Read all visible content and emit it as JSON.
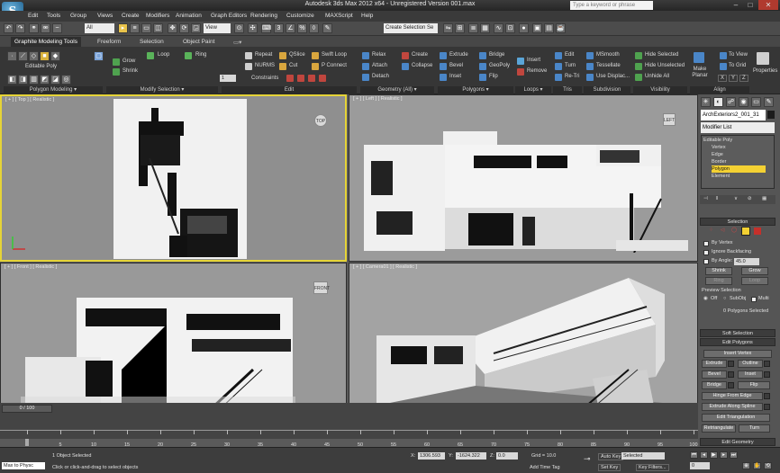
{
  "app": {
    "title": "Autodesk 3ds Max  2012 x64    - Unregistered Version   001.max",
    "search_placeholder": "Type a keyword or phrase",
    "logo_text": "S"
  },
  "menu": [
    "Edit",
    "Tools",
    "Group",
    "Views",
    "Create",
    "Modifiers",
    "Animation",
    "Graph Editors",
    "Rendering",
    "Customize",
    "MAXScript",
    "Help"
  ],
  "toolbar": {
    "selection_filter": "All",
    "ref_coord": "View",
    "named_selection": "Create Selection Se"
  },
  "ribbon": {
    "tabs": [
      "Graphite Modeling Tools",
      "Freeform",
      "Selection",
      "Object Paint"
    ],
    "object_type": "Editable Poly",
    "panels": {
      "polygon_modeling": "Polygon Modeling ▾",
      "modify_selection": "Modify Selection ▾",
      "edit": "Edit",
      "geometry_all": "Geometry (All) ▾",
      "polygons": "Polygons ▾",
      "loops": "Loops ▾",
      "tris": "Tris",
      "subdivision": "Subdivision",
      "visibility": "Visibility",
      "align": "Align",
      "properties": "Properties"
    },
    "modify_selection": {
      "grow": "Grow",
      "shrink": "Shrink",
      "loop": "Loop",
      "ring": "Ring"
    },
    "edit": {
      "repeat": "Repeat",
      "nurms": "NURMS",
      "constraints": "Constraints",
      "qslice": "QSlice",
      "cut": "Cut",
      "swift_loop": "Swift Loop",
      "p_connect": "P Connect",
      "count": "1"
    },
    "geometry": {
      "relax": "Relax",
      "attach": "Attach",
      "detach": "Detach",
      "create": "Create",
      "collapse": "Collapse"
    },
    "polygons": {
      "extrude": "Extrude",
      "bevel": "Bevel",
      "inset": "Inset",
      "bridge": "Bridge",
      "geopoly": "GeoPoly",
      "flip": "Flip",
      "insert": "Insert",
      "remove": "Remove"
    },
    "tris": {
      "edit": "Edit",
      "turn": "Turn",
      "retri": "Re-Tri"
    },
    "subdivision": {
      "msmooth": "MSmooth",
      "tessellate": "Tessellate",
      "use_displac": "Use Displac..."
    },
    "visibility": {
      "hide_selected": "Hide Selected",
      "hide_unselected": "Hide Unselected",
      "unhide_all": "Unhide All"
    },
    "align": {
      "make_planar": "Make Planar",
      "to_view": "To View",
      "to_grid": "To Grid",
      "x": "X",
      "y": "Y",
      "z": "Z"
    }
  },
  "viewports": {
    "top": "[ + ] [ Top ] [ Realistic ]",
    "left": "[ + ] [ Left ] [ Realistic ]",
    "front": "[ + ] [ Front ] [ Realistic ]",
    "camera": "[ + ] [ Camera01 ] [ Realistic ]",
    "cube_top": "TOP",
    "cube_left": "LEFT",
    "cube_front": "FRONT"
  },
  "command_panel": {
    "object_name": "ArchExteriors2_001_31",
    "modifier_list": "Modifier List",
    "stack": [
      "Editable Poly",
      "Vertex",
      "Edge",
      "Border",
      "Polygon",
      "Element"
    ],
    "selected_stack": "Polygon",
    "selection_title": "Selection",
    "by_vertex": "By Vertex",
    "ignore_backfacing": "Ignore Backfacing",
    "by_angle": "By Angle:",
    "angle_value": "45.0",
    "shrink": "Shrink",
    "grow": "Grow",
    "ring": "Ring",
    "loop": "Loop",
    "preview_selection": "Preview Selection",
    "off": "Off",
    "subobj": "SubObj",
    "multi": "Multi",
    "selected_count": "0 Polygons Selected",
    "soft_selection": "Soft Selection",
    "edit_polygons": "Edit Polygons",
    "insert_vertex": "Insert Vertex",
    "extrude": "Extrude",
    "outline": "Outline",
    "bevel": "Bevel",
    "inset": "Inset",
    "bridge": "Bridge",
    "flip": "Flip",
    "hinge_from_edge": "Hinge From Edge",
    "extrude_along_spline": "Extrude Along Spline",
    "edit_triangulation": "Edit Triangulation",
    "retriangulate": "Retriangulate",
    "turn": "Turn",
    "edit_geometry": "Edit Geometry"
  },
  "timeline": {
    "slider": "0 / 100",
    "ticks": [
      "0",
      "5",
      "10",
      "15",
      "20",
      "25",
      "30",
      "35",
      "40",
      "45",
      "50",
      "55",
      "60",
      "65",
      "70",
      "75",
      "80",
      "85",
      "90",
      "95",
      "100"
    ]
  },
  "status": {
    "script_listener": "Max to Physc",
    "objects_selected": "1 Object Selected",
    "prompt": "Click or click-and-drag to select objects",
    "x_label": "X:",
    "x_value": "1306.593",
    "y_label": "Y:",
    "y_value": "-1624.322",
    "z_label": "Z:",
    "z_value": "0.0",
    "grid": "Grid = 10.0",
    "add_time_tag": "Add Time Tag",
    "auto_key": "Auto Key",
    "auto_key_value": "Selected",
    "set_key": "Set Key",
    "key_filters": "Key Filters...",
    "frame": "0"
  }
}
